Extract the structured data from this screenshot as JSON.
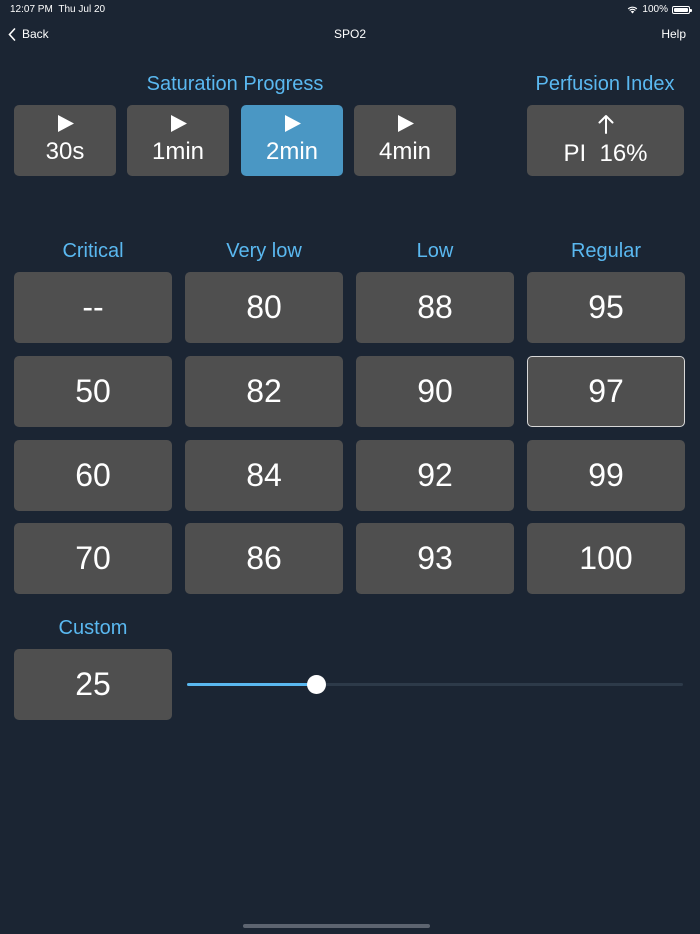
{
  "status_bar": {
    "time": "12:07 PM",
    "date": "Thu Jul 20",
    "battery": "100%"
  },
  "nav": {
    "back": "Back",
    "title": "SPO2",
    "help": "Help"
  },
  "saturation": {
    "label": "Saturation Progress",
    "buttons": [
      {
        "label": "30s"
      },
      {
        "label": "1min"
      },
      {
        "label": "2min"
      },
      {
        "label": "4min"
      }
    ],
    "active": "2min"
  },
  "perfusion": {
    "label": "Perfusion Index",
    "value": "PI  16%"
  },
  "grid": {
    "headers": [
      "Critical",
      "Very low",
      "Low",
      "Regular"
    ],
    "rows": [
      [
        "--",
        "80",
        "88",
        "95"
      ],
      [
        "50",
        "82",
        "90",
        "97"
      ],
      [
        "60",
        "84",
        "92",
        "99"
      ],
      [
        "70",
        "86",
        "93",
        "100"
      ]
    ],
    "selected": "97"
  },
  "custom": {
    "label": "Custom",
    "value": "25",
    "slider_fraction": 0.26
  },
  "colors": {
    "accent": "#5ab8f0",
    "tile": "#4f4f4f",
    "active": "#4a97c4",
    "background": "#1b2533"
  }
}
